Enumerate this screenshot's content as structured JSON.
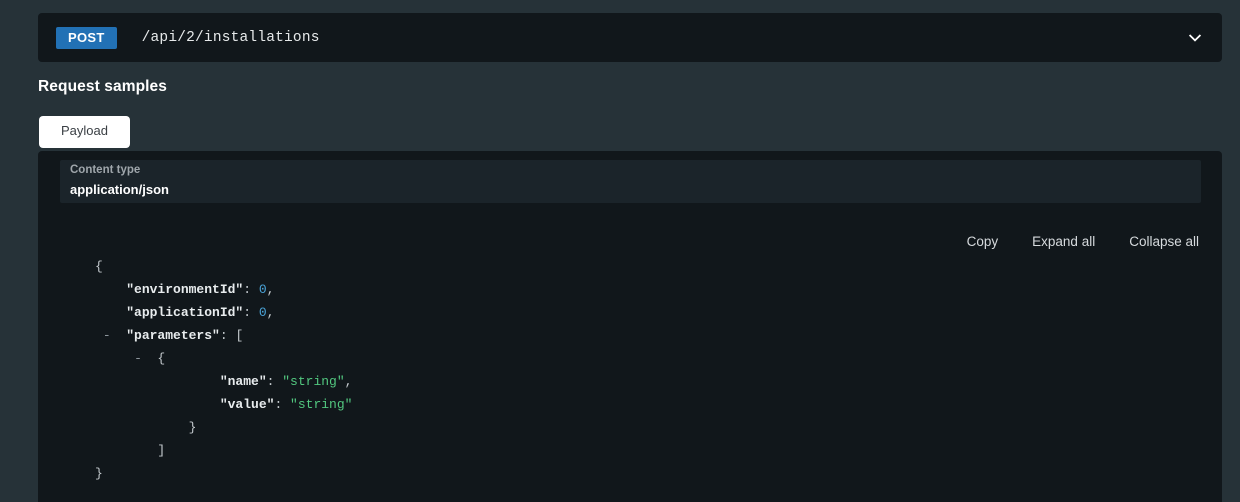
{
  "endpoint": {
    "method": "POST",
    "path": "/api/2/installations",
    "expand_icon": "chevron-down-icon"
  },
  "section": {
    "title": "Request samples"
  },
  "tabs": [
    {
      "label": "Payload",
      "active": true
    }
  ],
  "content_type": {
    "label": "Content type",
    "value": "application/json"
  },
  "code_toolbar": {
    "copy": "Copy",
    "expand_all": "Expand all",
    "collapse_all": "Collapse all"
  },
  "code": {
    "language": "json",
    "lines": [
      {
        "indent": 0,
        "toggle": "",
        "tokens": [
          {
            "t": "{",
            "c": "punc"
          }
        ]
      },
      {
        "indent": 1,
        "toggle": "",
        "tokens": [
          {
            "t": "\"environmentId\"",
            "c": "key"
          },
          {
            "t": ": ",
            "c": "punc"
          },
          {
            "t": "0",
            "c": "num"
          },
          {
            "t": ",",
            "c": "punc"
          }
        ]
      },
      {
        "indent": 1,
        "toggle": "",
        "tokens": [
          {
            "t": "\"applicationId\"",
            "c": "key"
          },
          {
            "t": ": ",
            "c": "punc"
          },
          {
            "t": "0",
            "c": "num"
          },
          {
            "t": ",",
            "c": "punc"
          }
        ]
      },
      {
        "indent": 1,
        "toggle": "-",
        "tokens": [
          {
            "t": "\"parameters\"",
            "c": "key"
          },
          {
            "t": ": [",
            "c": "punc"
          }
        ]
      },
      {
        "indent": 2,
        "toggle": "-",
        "tokens": [
          {
            "t": "{",
            "c": "punc"
          }
        ]
      },
      {
        "indent": 4,
        "toggle": "",
        "tokens": [
          {
            "t": "\"name\"",
            "c": "key"
          },
          {
            "t": ": ",
            "c": "punc"
          },
          {
            "t": "\"string\"",
            "c": "str"
          },
          {
            "t": ",",
            "c": "punc"
          }
        ]
      },
      {
        "indent": 4,
        "toggle": "",
        "tokens": [
          {
            "t": "\"value\"",
            "c": "key"
          },
          {
            "t": ": ",
            "c": "punc"
          },
          {
            "t": "\"string\"",
            "c": "str"
          }
        ]
      },
      {
        "indent": 3,
        "toggle": "",
        "tokens": [
          {
            "t": "}",
            "c": "punc"
          }
        ]
      },
      {
        "indent": 2,
        "toggle": "",
        "tokens": [
          {
            "t": "]",
            "c": "punc"
          }
        ]
      },
      {
        "indent": 0,
        "toggle": "",
        "tokens": [
          {
            "t": "}",
            "c": "punc"
          }
        ]
      }
    ]
  },
  "colors": {
    "page_background": "#263238",
    "panel_background": "#11171b",
    "method_badge": "#2271b5",
    "tab_active_background": "#ffffff",
    "select_background": "#1b242a",
    "json_key": "#e8ecee",
    "json_number": "#4aa4d8",
    "json_string": "#52c77f",
    "json_punctuation": "#c3c9cd"
  }
}
